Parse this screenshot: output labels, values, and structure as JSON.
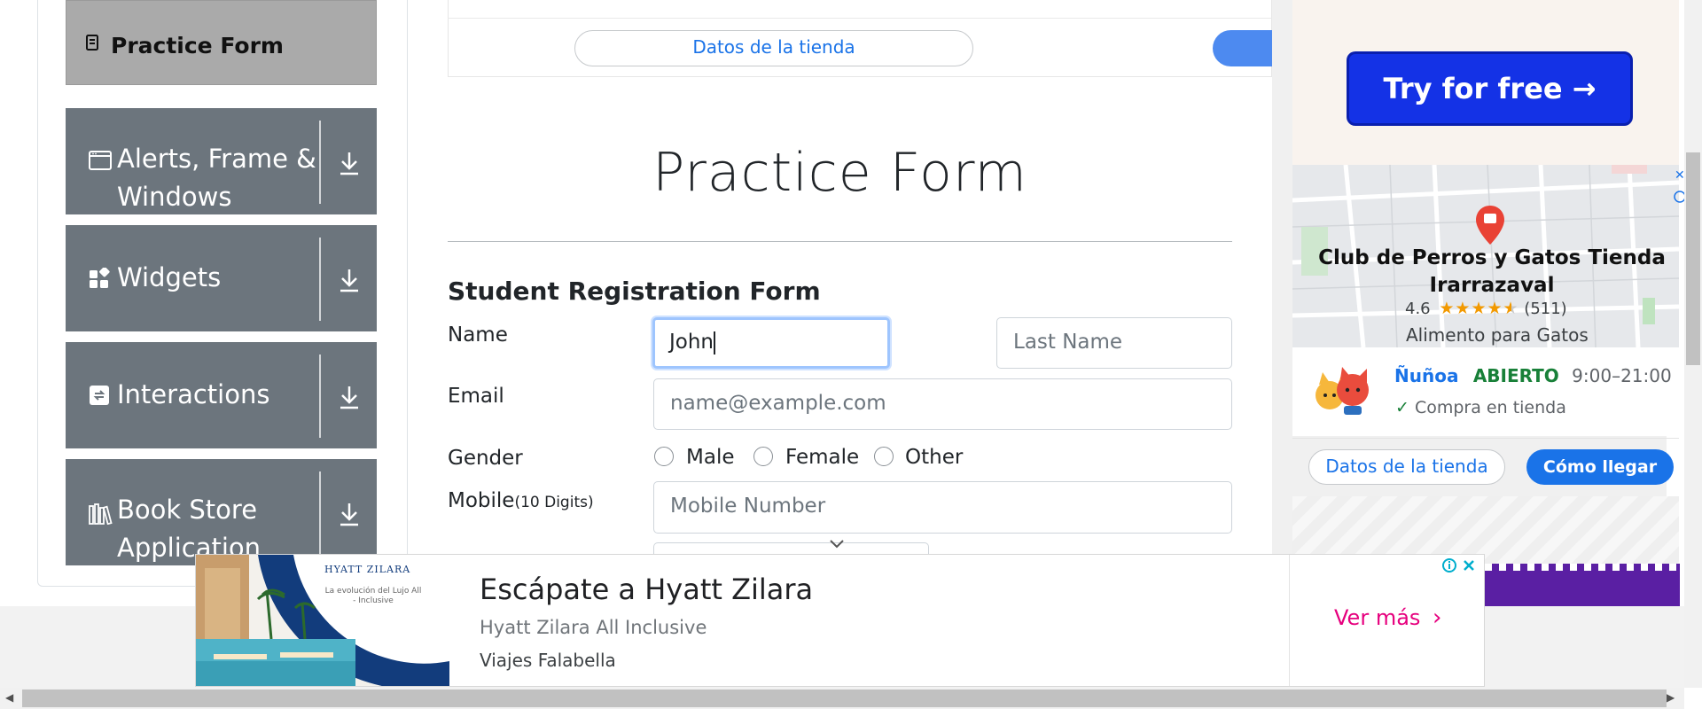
{
  "sidebar": {
    "active_item": "Practice Form",
    "items": [
      {
        "label_line1": "Alerts, Frame &",
        "label_line2": "Windows",
        "icon": "window-icon"
      },
      {
        "label_line1": "Widgets",
        "label_line2": "",
        "icon": "widgets-icon"
      },
      {
        "label_line1": "Interactions",
        "label_line2": "",
        "icon": "interactions-icon"
      },
      {
        "label_line1": "Book Store",
        "label_line2": "Application",
        "icon": "books-icon"
      }
    ]
  },
  "top_strip": {
    "store_details_label": "Datos de la tienda"
  },
  "form": {
    "page_title": "Practice Form",
    "form_title": "Student Registration Form",
    "name_label": "Name",
    "first_name_value": "John",
    "last_name_placeholder": "Last Name",
    "email_label": "Email",
    "email_placeholder": "name@example.com",
    "gender_label": "Gender",
    "gender_options": [
      "Male",
      "Female",
      "Other"
    ],
    "mobile_label": "Mobile",
    "mobile_hint": "(10 Digits)",
    "mobile_placeholder": "Mobile Number"
  },
  "right_ad": {
    "cta_label": "Try for free →",
    "store_name_line1": "Club de Perros y Gatos Tienda",
    "store_name_line2": "Irarrazaval",
    "rating": "4.6",
    "stars": 4.5,
    "review_count": "(511)",
    "category": "Alimento para Gatos",
    "location": "Ñuñoa",
    "status": "ABIERTO",
    "hours": "9:00–21:00",
    "in_store": "Compra en tienda",
    "store_details_label": "Datos de la tienda",
    "directions_label": "Cómo llegar",
    "colors": {
      "link": "#1a73e8",
      "open": "#188038",
      "star": "#f29900"
    }
  },
  "bottom_ad": {
    "logo_text": "HYATT ZILARA",
    "tagline": "La evolución del Lujo All - Inclusive",
    "headline": "Escápate a Hyatt Zilara",
    "subtitle": "Hyatt Zilara All Inclusive",
    "advertiser": "Viajes Falabella",
    "cta": "Ver más",
    "cta_color": "#e6007e"
  }
}
